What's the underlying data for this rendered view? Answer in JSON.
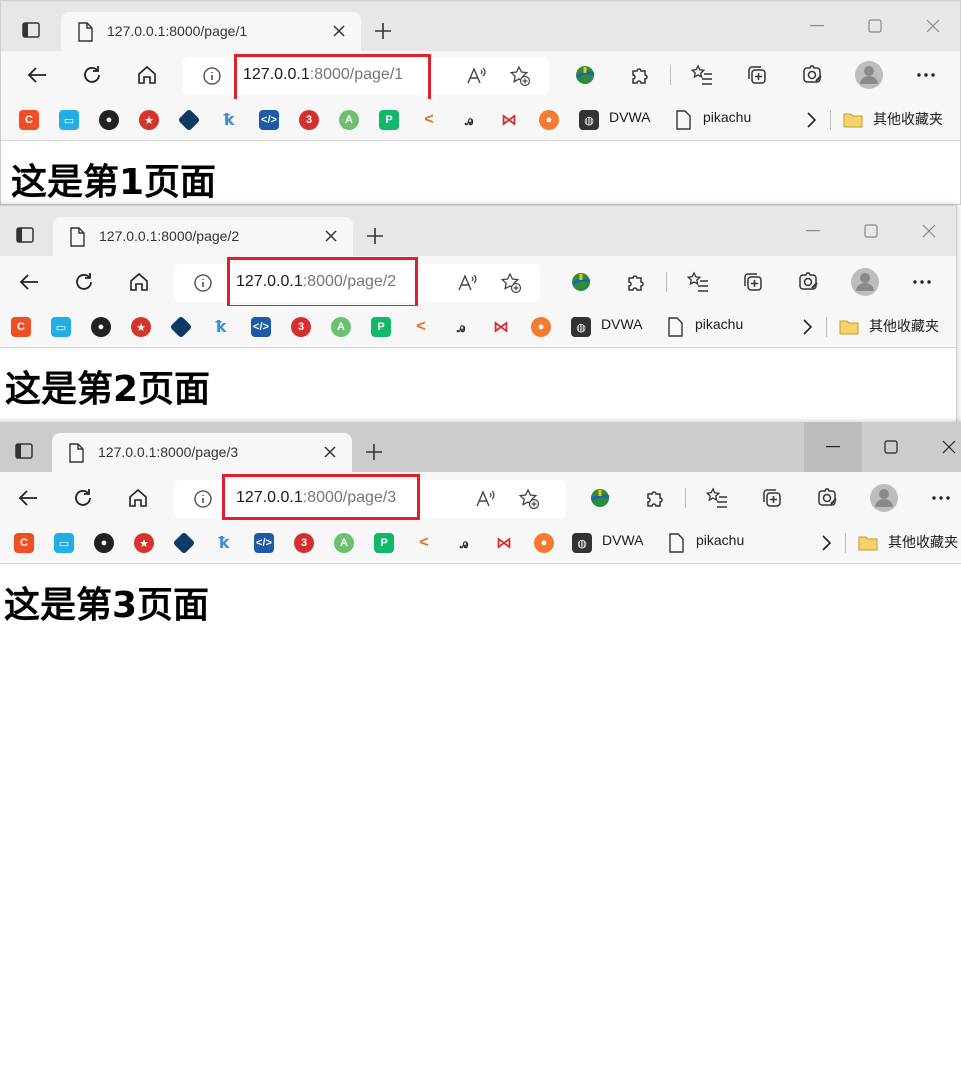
{
  "windows": [
    {
      "tab_title": "127.0.0.1:8000/page/1",
      "url_host": "127.0.0.1",
      "url_path": ":8000/page/1",
      "heading": "这是第1页面"
    },
    {
      "tab_title": "127.0.0.1:8000/page/2",
      "url_host": "127.0.0.1",
      "url_path": ":8000/page/2",
      "heading": "这是第2页面"
    },
    {
      "tab_title": "127.0.0.1:8000/page/3",
      "url_host": "127.0.0.1",
      "url_path": ":8000/page/3",
      "heading": "这是第3页面"
    }
  ],
  "favorites": {
    "dvwa_label": "DVWA",
    "pikachu_label": "pikachu",
    "other_label": "其他收藏夹"
  },
  "colors": {
    "highlight": "#e0202a",
    "titlebar": "#e7e7e7",
    "toolbar": "#f7f7f7"
  }
}
